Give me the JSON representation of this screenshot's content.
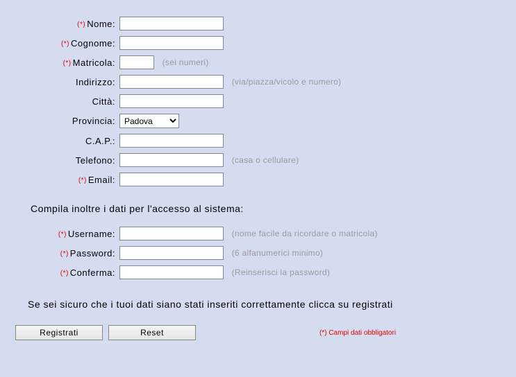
{
  "req_marker": "(*)",
  "fields": {
    "nome": {
      "label": "Nome:",
      "required": true,
      "hint": "",
      "width": "w150"
    },
    "cognome": {
      "label": "Cognome:",
      "required": true,
      "hint": "",
      "width": "w150"
    },
    "matricola": {
      "label": "Matricola:",
      "required": true,
      "hint": "(sei numeri)",
      "width": "w50"
    },
    "indirizzo": {
      "label": "Indirizzo:",
      "required": false,
      "hint": "(via/piazza/vicolo e numero)",
      "width": "w150"
    },
    "citta": {
      "label": "Città:",
      "required": false,
      "hint": "",
      "width": "w150"
    },
    "provincia": {
      "label": "Provincia:",
      "required": false,
      "selected": "Padova",
      "width": "w86"
    },
    "cap": {
      "label": "C.A.P.:",
      "required": false,
      "hint": "",
      "width": "w150"
    },
    "telefono": {
      "label": "Telefono:",
      "required": false,
      "hint": "(casa o cellulare)",
      "width": "w150"
    },
    "email": {
      "label": "Email:",
      "required": true,
      "hint": "",
      "width": "w150"
    },
    "username": {
      "label": "Username:",
      "required": true,
      "hint": "(nome facile da ricordare o matricola)",
      "width": "w150"
    },
    "password": {
      "label": "Password:",
      "required": true,
      "hint": "(6 alfanumerici minimo)",
      "width": "w150"
    },
    "conferma": {
      "label": "Conferma:",
      "required": true,
      "hint": "(Reinserisci la password)",
      "width": "w150"
    }
  },
  "section_access": "Compila inoltre i dati per l'accesso al sistema:",
  "confirm_text": "Se sei sicuro che i tuoi dati siano stati inseriti correttamente clicca su registrati",
  "buttons": {
    "submit": "Registrati",
    "reset": "Reset"
  },
  "footnote": "(*) Campi dati obbligatori"
}
